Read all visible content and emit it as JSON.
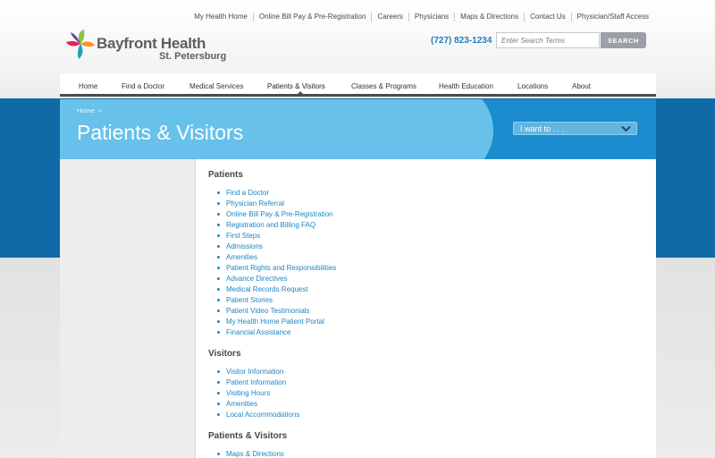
{
  "utility_nav": [
    "My Health Home",
    "Online Bill Pay & Pre-Registration",
    "Careers",
    "Physicians",
    "Maps & Directions",
    "Contact Us",
    "Physician/Staff Access"
  ],
  "logo": {
    "name": "Bayfront Health",
    "subname": "St. Petersburg"
  },
  "phone": "(727) 823-1234",
  "search": {
    "placeholder": "Enter Search Terms",
    "button": "SEARCH"
  },
  "main_nav": {
    "items": [
      "Home",
      "Find a Doctor",
      "Medical Services",
      "Patients & Visitors",
      "Classes & Programs",
      "Health Education",
      "Locations",
      "About"
    ],
    "active": "Patients & Visitors"
  },
  "breadcrumb": {
    "home": "Home",
    "separator": "»"
  },
  "page_title": "Patients & Visitors",
  "iwant": {
    "label": "I want to . . ."
  },
  "sections": [
    {
      "title": "Patients",
      "links": [
        "Find a Doctor",
        "Physician Referral",
        "Online Bill Pay & Pre-Registration",
        "Registration and Billing FAQ",
        "First Steps",
        "Admissions",
        "Amenities",
        "Patient Rights and Responsibilities",
        "Advance Directives",
        "Medical Records Request",
        "Patient Stories",
        "Patient Video Testimonials",
        "My Health Home Patient Portal",
        "Financial Assistance"
      ]
    },
    {
      "title": "Visitors",
      "links": [
        "Visitor Information",
        "Patient Information",
        "Visiting Hours",
        "Amenities",
        "Local Accommodations"
      ]
    },
    {
      "title": "Patients & Visitors",
      "links": [
        "Maps & Directions"
      ]
    }
  ],
  "colors": {
    "brand_blue": "#1b8ccd",
    "light_blue": "#67c1ea",
    "dark_blue": "#0f6aa6",
    "link": "#1d86c6",
    "text_grey": "#5b5f63",
    "logo_green": "#8cc63f",
    "logo_orange": "#f7941d",
    "logo_red": "#e2235a",
    "logo_teal": "#1ba3b8",
    "logo_purple": "#6c4b9c"
  }
}
